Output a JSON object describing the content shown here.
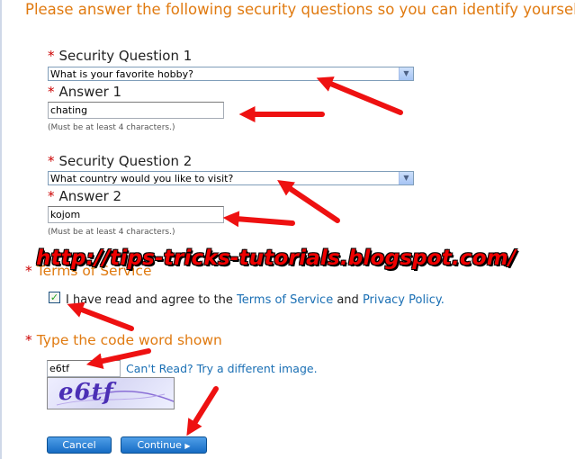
{
  "heading": "Please answer the following security questions so you can identify yourself when managing your account.",
  "required_marker": "*",
  "q1": {
    "label": "Security Question 1",
    "selected": "What is your favorite hobby?",
    "answer_label": "Answer 1",
    "answer_value": "chating",
    "hint": "(Must be at least 4 characters.)"
  },
  "q2": {
    "label": "Security Question 2",
    "selected": "What country would you like to visit?",
    "answer_label": "Answer 2",
    "answer_value": "kojom",
    "hint": "(Must be at least 4 characters.)"
  },
  "terms": {
    "label": "Terms of Service",
    "checkbox_checked": true,
    "text_before": "I have read and agree to the",
    "tos_link": "Terms of Service",
    "and": "and",
    "privacy_link": "Privacy Policy",
    "period": "."
  },
  "captcha": {
    "label": "Type the code word shown",
    "input_value": "e6tf",
    "cant_read_link": "Can't Read? Try a different image.",
    "image_text": "e6tf"
  },
  "buttons": {
    "cancel": "Cancel",
    "continue": "Continue"
  },
  "watermark": "http://tips-tricks-tutorials.blogspot.com/",
  "colors": {
    "heading": "#e07a10",
    "required": "#cc0000",
    "link": "#1a6fb4",
    "button": "#166cc4",
    "arrow": "#ee1111"
  },
  "icons": {
    "dropdown": "chevron-down-icon",
    "checkbox": "check-icon",
    "continue": "triangle-right-icon"
  }
}
